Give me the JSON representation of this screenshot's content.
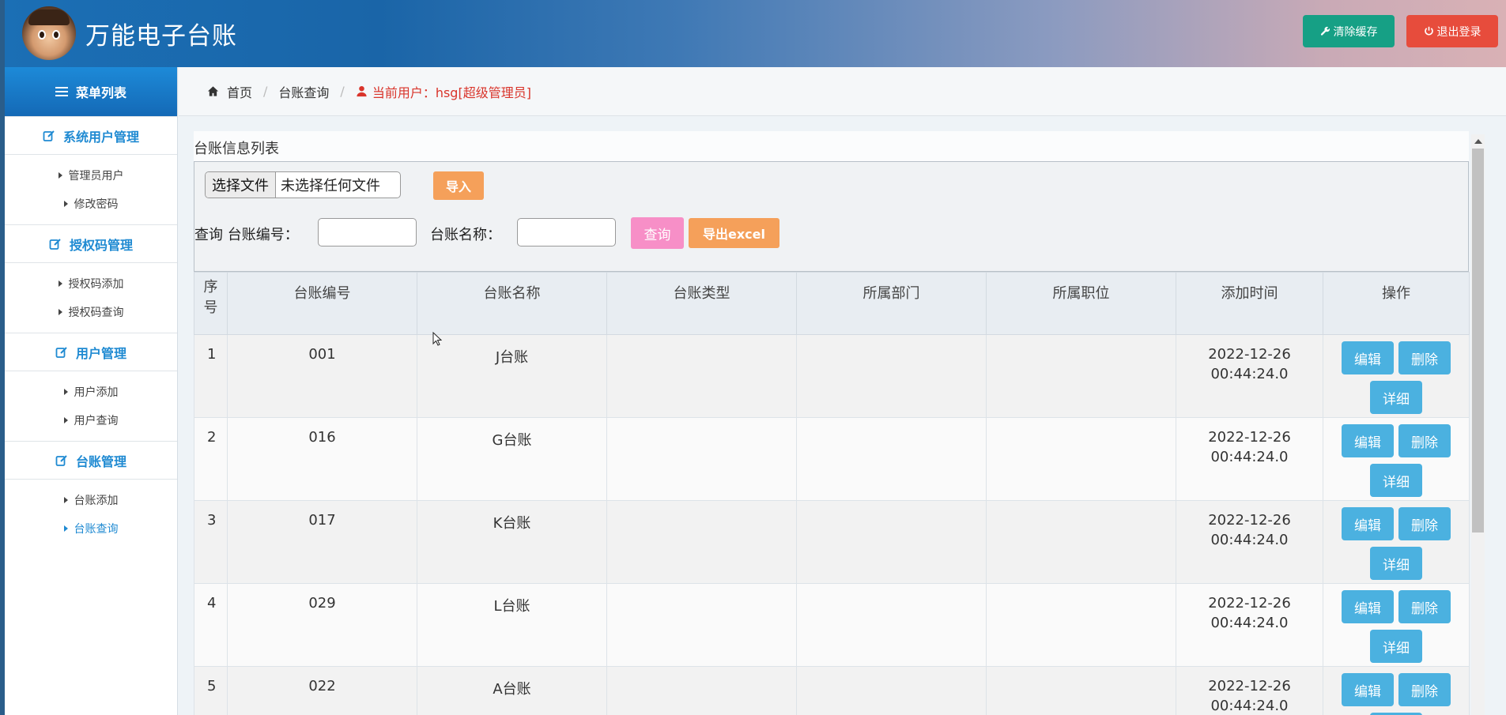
{
  "header": {
    "title": "万能电子台账",
    "clear_cache": "清除缓存",
    "logout": "退出登录",
    "colors": {
      "clear": "#16a085",
      "logout": "#e74c3c"
    }
  },
  "sidebar": {
    "menu_title": "菜单列表",
    "groups": [
      {
        "title": "系统用户管理",
        "items": [
          "管理员用户",
          "修改密码"
        ]
      },
      {
        "title": "授权码管理",
        "items": [
          "授权码添加",
          "授权码查询"
        ]
      },
      {
        "title": "用户管理",
        "items": [
          "用户添加",
          "用户查询"
        ]
      },
      {
        "title": "台账管理",
        "items": [
          "台账添加",
          "台账查询"
        ]
      }
    ],
    "active_item": "台账查询"
  },
  "breadcrumb": {
    "home": "首页",
    "current": "台账查询",
    "user": "当前用户：hsg[超级管理员]"
  },
  "panel": {
    "title": "台账信息列表",
    "file_choose": "选择文件",
    "file_none": "未选择任何文件",
    "import": "导入",
    "query_prefix": "查询 台账编号：",
    "name_label": "台账名称：",
    "query_btn": "查询",
    "export_btn": "导出excel",
    "id_input_value": "",
    "name_input_value": ""
  },
  "table": {
    "headers": [
      "序号",
      "台账编号",
      "台账名称",
      "台账类型",
      "所属部门",
      "所属职位",
      "添加时间",
      "操作"
    ],
    "rows": [
      {
        "idx": "1",
        "code": "001",
        "name": "J台账",
        "type": "",
        "dept": "",
        "pos": "",
        "date": "2022-12-26",
        "time": "00:44:24.0"
      },
      {
        "idx": "2",
        "code": "016",
        "name": "G台账",
        "type": "",
        "dept": "",
        "pos": "",
        "date": "2022-12-26",
        "time": "00:44:24.0"
      },
      {
        "idx": "3",
        "code": "017",
        "name": "K台账",
        "type": "",
        "dept": "",
        "pos": "",
        "date": "2022-12-26",
        "time": "00:44:24.0"
      },
      {
        "idx": "4",
        "code": "029",
        "name": "L台账",
        "type": "",
        "dept": "",
        "pos": "",
        "date": "2022-12-26",
        "time": "00:44:24.0"
      },
      {
        "idx": "5",
        "code": "022",
        "name": "A台账",
        "type": "",
        "dept": "",
        "pos": "",
        "date": "2022-12-26",
        "time": "00:44:24.0"
      }
    ],
    "ops": {
      "edit": "编辑",
      "delete": "删除",
      "detail": "详细"
    }
  }
}
